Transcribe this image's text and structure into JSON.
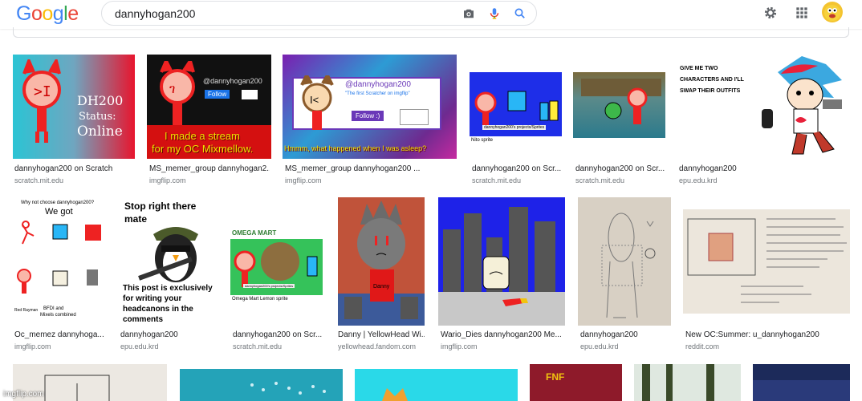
{
  "header": {
    "logo_letters": [
      "G",
      "o",
      "o",
      "g",
      "l",
      "e"
    ],
    "logo_colors": [
      "#4285F4",
      "#EA4335",
      "#FBBC05",
      "#4285F4",
      "#34A853",
      "#EA4335"
    ],
    "query": "dannyhogan200",
    "icons": [
      "camera-icon",
      "microphone-icon",
      "search-icon",
      "gear-icon",
      "apps-grid-icon",
      "avatar"
    ]
  },
  "results": [
    {
      "caption": "dannyhogan200 on Scratch",
      "source": "scratch.mit.edu",
      "overlay": [
        "DH200",
        "Status:",
        "Online"
      ]
    },
    {
      "caption": "MS_memer_group dannyhogan2...",
      "source": "imgflip.com",
      "overlay": [
        "@dannyhogan200",
        "Follow",
        "I made a stream",
        "for my OC Mixmellow."
      ]
    },
    {
      "caption": "MS_memer_group dannyhogan200 ...",
      "source": "imgflip.com",
      "overlay": [
        "@dannyhogan200",
        "\"The first Scratcher on imgflip\"",
        "Follow :)",
        "Hmmm, what happened when I was asleep?"
      ]
    },
    {
      "caption": "dannyhogan200 on Scr...",
      "source": "scratch.mit.edu",
      "overlay": [
        "dannyhogan200's projects/Sprites",
        "Nito sprite"
      ]
    },
    {
      "caption": "dannyhogan200 on Scr...",
      "source": "scratch.mit.edu",
      "overlay": []
    },
    {
      "caption": "dannyhogan200",
      "source": "epu.edu.krd",
      "overlay": [
        "GIVE ME TWO",
        "CHARACTERS AND I'LL",
        "SWAP THEIR OUTFITS"
      ]
    },
    {
      "caption": "Oc_memez dannyhoga...",
      "source": "imgflip.com",
      "overlay": [
        "Why not choose dannyhogan200?",
        "We got",
        "BFDI and",
        "Mixels combined",
        "Red Rayman"
      ]
    },
    {
      "caption": "dannyhogan200",
      "source": "epu.edu.krd",
      "overlay": [
        "Stop right there",
        "mate",
        "This post is exclusively",
        "for writing your",
        "headcanons in the",
        "comments"
      ]
    },
    {
      "caption": "dannyhogan200 on Scr...",
      "source": "scratch.mit.edu",
      "overlay": [
        "OMEGA MART",
        "dannyhogan200's projects/Sprites",
        "Omega Mart Lemon sprite"
      ]
    },
    {
      "caption": "Danny | YellowHead Wi...",
      "source": "yellowhead.fandom.com",
      "overlay": [
        "Danny"
      ]
    },
    {
      "caption": "Wario_Dies dannyhogan200 Me...",
      "source": "imgflip.com",
      "overlay": []
    },
    {
      "caption": "dannyhogan200",
      "source": "epu.edu.krd",
      "overlay": []
    },
    {
      "caption": "New OC:Summer: u_dannyhogan200",
      "source": "reddit.com",
      "overlay": []
    }
  ],
  "footer_watermark": "imgflip.com",
  "colors": {
    "link_gray": "#70757a",
    "border": "#dadce0",
    "blue_accent": "#4285F4"
  }
}
